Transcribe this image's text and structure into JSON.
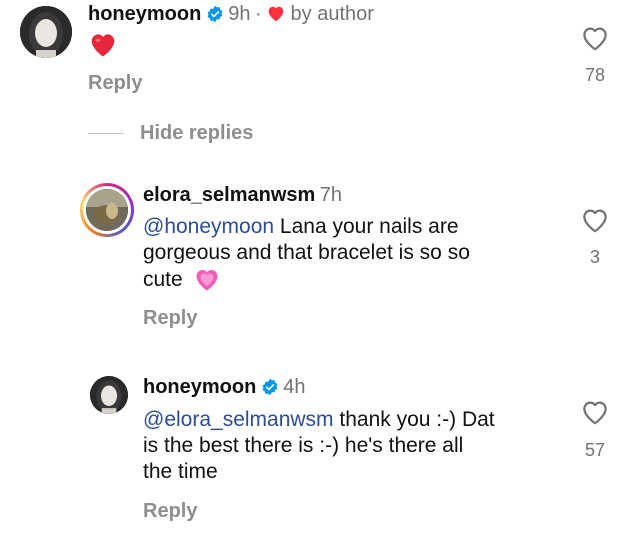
{
  "comments": [
    {
      "username": "honeymoon",
      "verified": true,
      "time": "9h",
      "separator": "·",
      "liked_by_author": "by author",
      "text": "",
      "emoji": "❤️",
      "reply_label": "Reply",
      "likes": "78"
    },
    {
      "username": "elora_selmanwsm",
      "verified": false,
      "time": "7h",
      "mention": "@honeymoon",
      "text_line1": " Lana your nails are",
      "text_line2": "gorgeous and that bracelet is so so",
      "text_line3": "cute",
      "emoji": "💗",
      "reply_label": "Reply",
      "likes": "3"
    },
    {
      "username": "honeymoon",
      "verified": true,
      "time": "4h",
      "mention": "@elora_selmanwsm",
      "text_line1": " thank you :-) Dat",
      "text_line2": "is the best there is :-) he's there all",
      "text_line3": "the time",
      "reply_label": "Reply",
      "likes": "57"
    }
  ],
  "hide_replies_label": "Hide replies",
  "colors": {
    "verified_blue": "#0095f6",
    "heart_red": "#ff3040",
    "mention_blue": "#2b4c9b",
    "muted_gray": "#737373"
  },
  "icons": {
    "like": "heart-outline-icon",
    "verified": "verified-badge-icon",
    "author_like": "filled-heart-icon"
  }
}
